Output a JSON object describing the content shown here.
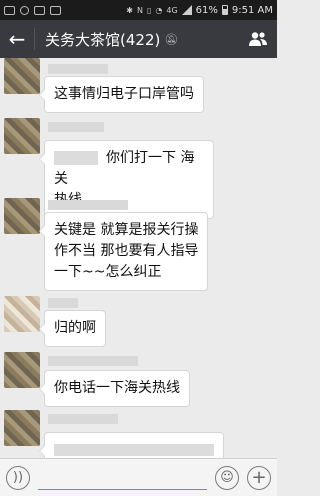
{
  "status_bar": {
    "battery": "61%",
    "time": "9:51 AM",
    "network": "4G"
  },
  "header": {
    "back_icon": "arrow-left-icon",
    "title": "关务大茶馆(422)",
    "mute_icon": "mute-bell-icon",
    "members_icon": "group-members-icon"
  },
  "messages": [
    {
      "text": "这事情归电子口岸管吗"
    },
    {
      "text": "你们打一下 海关\n热线",
      "mention_hidden": true
    },
    {
      "text": "关键是 就算是报关行操\n作不当 那也要有人指导\n一下~~怎么纠正"
    },
    {
      "text": "归的啊"
    },
    {
      "text": "你电话一下海关热线"
    },
    {
      "text": "",
      "blurred": true
    }
  ],
  "input_bar": {
    "voice_icon": "voice-icon",
    "emoji_icon": "emoji-icon",
    "plus_icon": "plus-icon"
  }
}
